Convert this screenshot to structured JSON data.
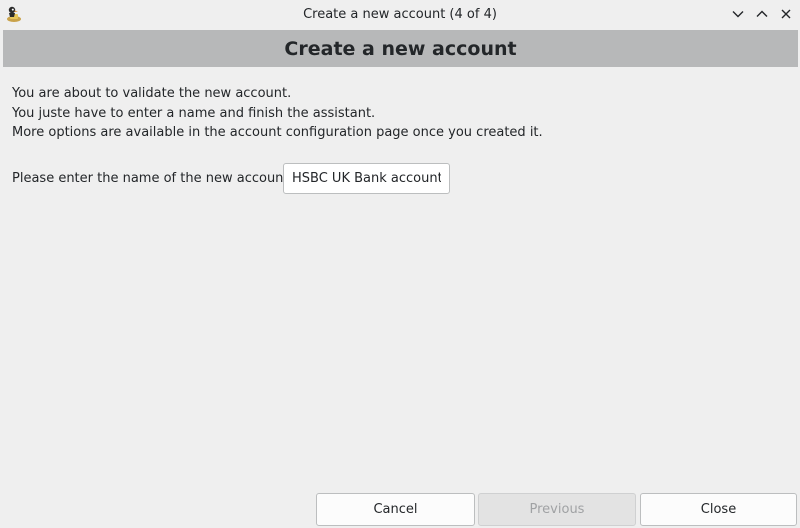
{
  "window": {
    "title": "Create a new account (4 of 4)",
    "app_icon": "grisbi-app-icon"
  },
  "window_controls": {
    "minimize_icon": "chevron-down-icon",
    "maximize_icon": "chevron-up-icon",
    "close_icon": "close-icon"
  },
  "banner": {
    "title": "Create a new account"
  },
  "intro": {
    "lines": [
      "You are about to validate the new account.",
      "You juste have to enter a name and finish the assistant.",
      "More options are available in the account configuration page once you created it."
    ]
  },
  "form": {
    "name_label": "Please enter the name of the new account:",
    "name_value": "HSBC UK Bank account"
  },
  "buttons": {
    "cancel": "Cancel",
    "previous": "Previous",
    "close": "Close",
    "previous_enabled": false
  },
  "colors": {
    "background": "#efefef",
    "banner": "#b7b8b9",
    "text": "#232629",
    "disabled_text": "#a0a2a4"
  }
}
